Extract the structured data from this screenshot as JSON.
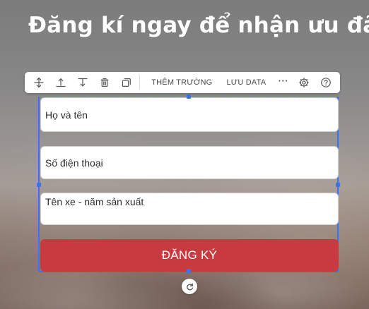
{
  "page": {
    "headline": "Đăng kí ngay để nhận ưu đãi"
  },
  "toolbar": {
    "buttons": [
      {
        "icon": "move-vertical-icon"
      },
      {
        "icon": "upload-icon"
      },
      {
        "icon": "download-icon"
      },
      {
        "icon": "trash-icon"
      },
      {
        "icon": "duplicate-icon"
      }
    ],
    "add_field_label": "THÊM TRƯỜNG",
    "save_data_label": "LƯU DATA",
    "more_label": "···",
    "settings_icon": "gear-icon",
    "help_icon": "help-icon"
  },
  "form": {
    "fields": [
      {
        "label": "Họ và tên"
      },
      {
        "label": "Số điện thoại"
      },
      {
        "label": "Tên xe - năm sản xuất"
      }
    ],
    "submit_label": "ĐĂNG KÝ"
  },
  "colors": {
    "submit_button": "#c73b40",
    "selection": "#3d73e8",
    "headline": "#ffffff"
  },
  "controls": {
    "rotate_icon": "rotate-icon"
  }
}
